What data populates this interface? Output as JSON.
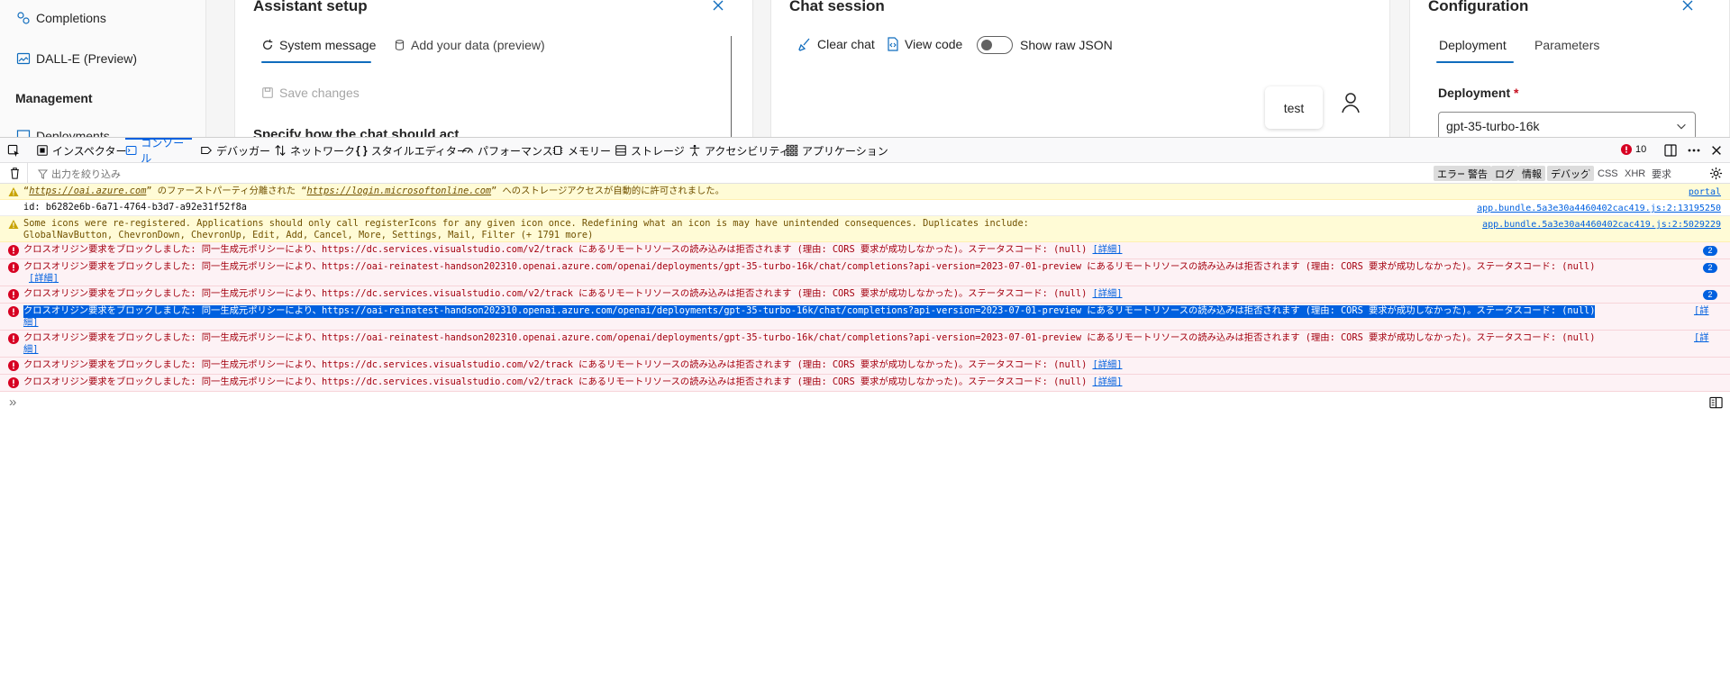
{
  "sidebar": {
    "completions": "Completions",
    "dalle": "DALL-E (Preview)",
    "management_header": "Management",
    "partial": "Deployments"
  },
  "assistant": {
    "title": "Assistant setup",
    "tabs": [
      "System message",
      "Add your data (preview)"
    ],
    "save_changes": "Save changes",
    "prompt_heading": "Specify how the chat should act"
  },
  "chat": {
    "title": "Chat session",
    "clear_chat": "Clear chat",
    "view_code": "View code",
    "show_raw_json": "Show raw JSON",
    "user_message": "test"
  },
  "config": {
    "title": "Configuration",
    "tabs": [
      "Deployment",
      "Parameters"
    ],
    "deployment_label": "Deployment",
    "required_mark": "*",
    "deployment_value": "gpt-35-turbo-16k"
  },
  "devtools": {
    "tabs": [
      "インスペクター",
      "コンソール",
      "デバッガー",
      "ネットワーク",
      "スタイルエディター",
      "パフォーマンス",
      "メモリー",
      "ストレージ",
      "アクセシビリティ",
      "アプリケーション"
    ],
    "error_count": "10",
    "filter_placeholder": "出力を絞り込み",
    "filters": [
      "エラー",
      "警告",
      "ログ",
      "情報",
      "デバッグ",
      "CSS",
      "XHR",
      "要求"
    ]
  },
  "messages": {
    "m1_q1": "“",
    "m1_url1": "https://oai.azure.com",
    "m1_mid": "” のファーストパーティ分離された “",
    "m1_url2": "https://login.microsoftonline.com",
    "m1_end": "” へのストレージアクセスが自動的に許可されました。",
    "m1_src": "portal",
    "m2_text": "id: b6282e6b-6a71-4764-b3d7-a92e31f52f8a",
    "m2_src": "app.bundle.5a3e30a4460402cac419.js:2:13195250",
    "m3_line1": "Some icons were re-registered. Applications should only call registerIcons for any given icon once. Redefining what an icon is may have unintended consequences. Duplicates include:",
    "m3_line2": "GlobalNavButton, ChevronDown, ChevronUp, Edit, Add, Cancel, More, Settings, Mail, Filter (+ 1791 more)",
    "m3_src": "app.bundle.5a3e30a4460402cac419.js:2:5029229",
    "cors_dc": "クロスオリジン要求をブロックしました: 同一生成元ポリシーにより、https://dc.services.visualstudio.com/v2/track にあるリモートリソースの読み込みは拒否されます (理由: CORS 要求が成功しなかった)。ステータスコード: (null)",
    "cors_oai": "クロスオリジン要求をブロックしました: 同一生成元ポリシーにより、https://oai-reinatest-handson202310.openai.azure.com/openai/deployments/gpt-35-turbo-16k/chat/completions?api-version=2023-07-01-preview にあるリモートリソースの読み込みは拒否されます (理由: CORS 要求が成功しなかった)。ステータスコード: (null)",
    "detail_open": "[",
    "detail_word": "詳細",
    "detail_close": "]",
    "detail_wrap_1": "[詳",
    "detail_wrap_2": "細]",
    "badge": "2"
  },
  "prompt_symbol": "»"
}
